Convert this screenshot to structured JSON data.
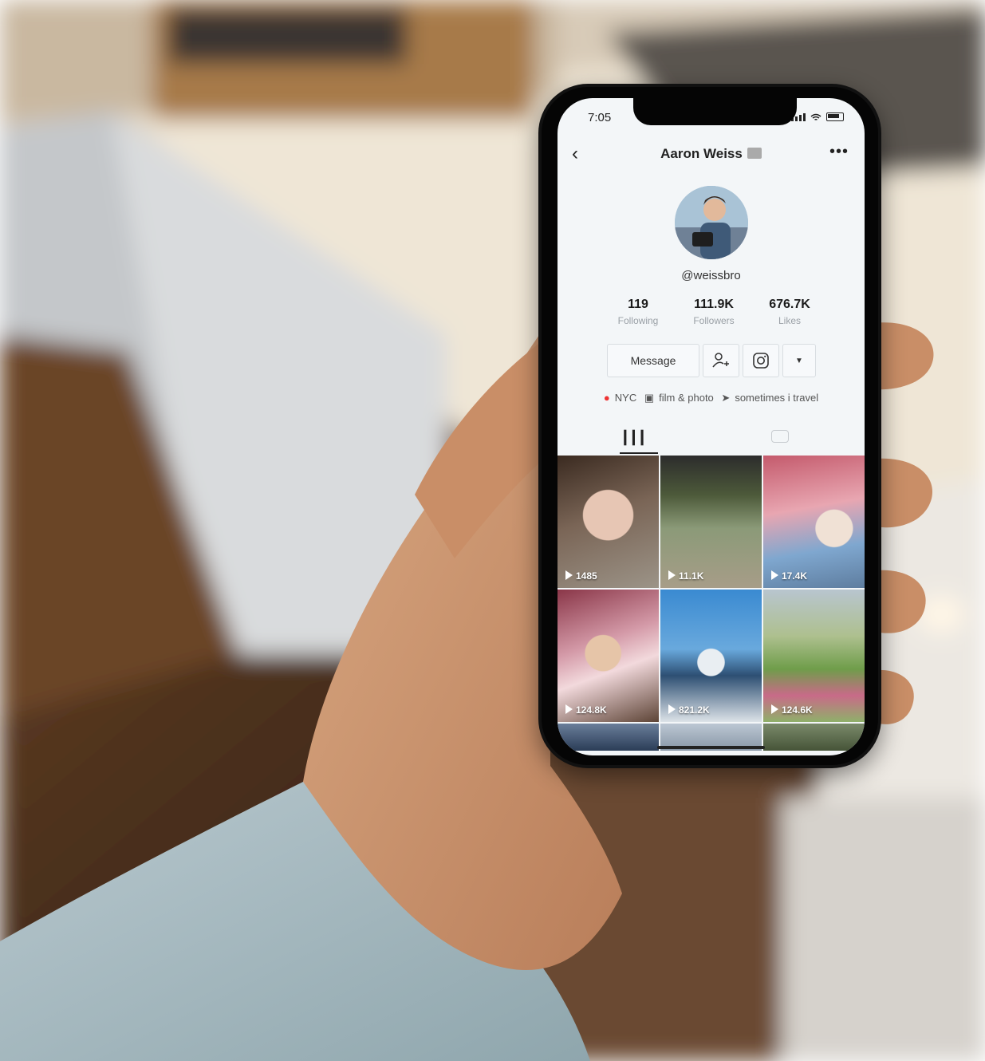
{
  "status_bar": {
    "time": "7:05"
  },
  "profile": {
    "name": "Aaron Weiss",
    "handle": "@weissbro",
    "stats": [
      {
        "value": "119",
        "label": "Following"
      },
      {
        "value": "111.9K",
        "label": "Followers"
      },
      {
        "value": "676.7K",
        "label": "Likes"
      }
    ],
    "message_label": "Message",
    "bio": [
      "NYC",
      "film & photo",
      "sometimes i travel"
    ]
  },
  "icons": {
    "back": "chevron-left-icon",
    "more": "more-dots-icon",
    "follow": "user-add-icon",
    "instagram": "instagram-icon",
    "dropdown": "caret-down-icon",
    "videos_tab": "grid-icon",
    "liked_tab": "heart-hidden-icon",
    "location": "pin-icon",
    "camera": "camera-icon",
    "rocket": "rocket-icon"
  },
  "videos": [
    {
      "views": "1485"
    },
    {
      "views": "11.1K"
    },
    {
      "views": "17.4K"
    },
    {
      "views": "124.8K"
    },
    {
      "views": "821.2K"
    },
    {
      "views": "124.6K"
    }
  ]
}
